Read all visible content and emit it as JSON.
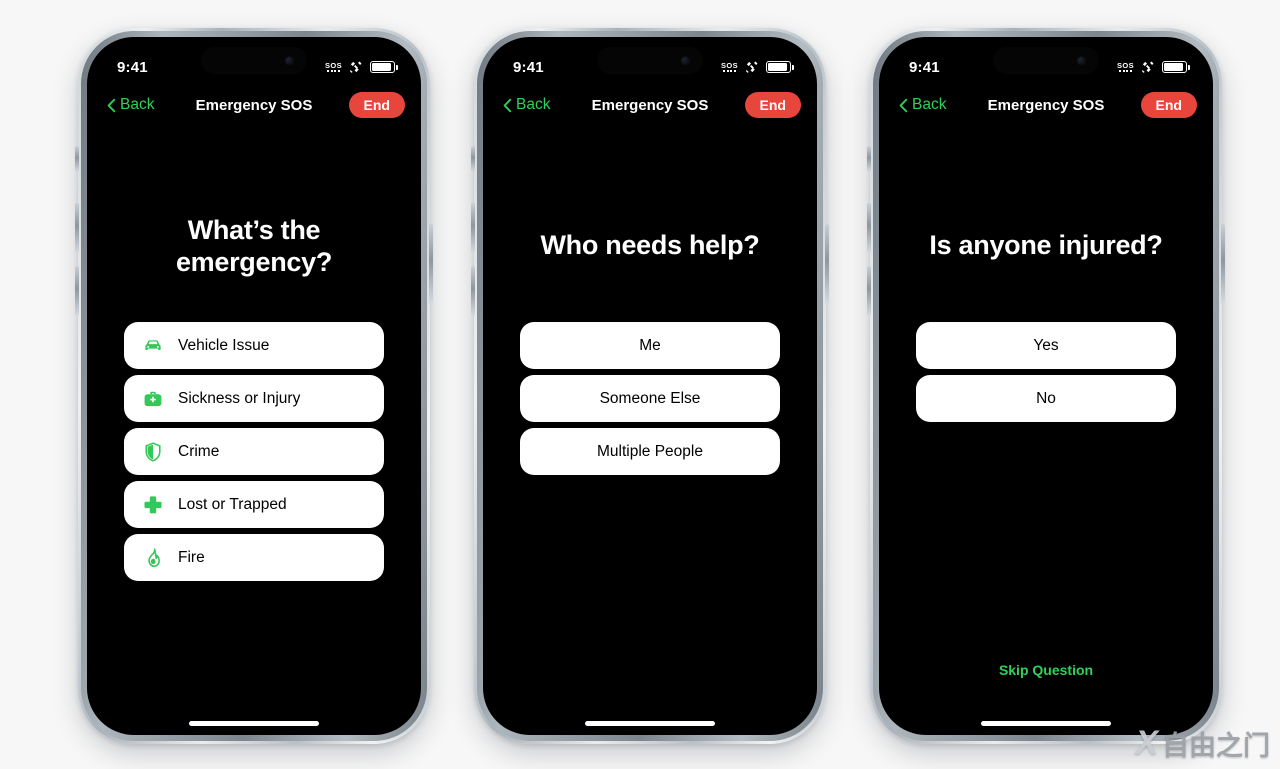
{
  "theme": {
    "page_background": "#f7f7f7",
    "screen_background": "#000000",
    "accent_green": "#30d158",
    "end_button_red": "#e8453c",
    "option_background": "#ffffff",
    "option_text": "#000000"
  },
  "status_bar": {
    "time": "9:41",
    "sos_label": "SOS",
    "satellite_icon": "satellite-icon",
    "battery_icon": "battery-icon"
  },
  "nav_bar": {
    "back_label": "Back",
    "back_icon": "chevron-left-icon",
    "title": "Emergency SOS",
    "end_label": "End"
  },
  "screens": [
    {
      "id": "what-emergency",
      "question": "What’s the emergency?",
      "options": [
        {
          "label": "Vehicle Issue",
          "icon": "car-icon"
        },
        {
          "label": "Sickness or Injury",
          "icon": "medical-bag-icon"
        },
        {
          "label": "Crime",
          "icon": "shield-icon"
        },
        {
          "label": "Lost or Trapped",
          "icon": "cross-icon"
        },
        {
          "label": "Fire",
          "icon": "flame-icon"
        }
      ],
      "skip_label": null
    },
    {
      "id": "who-needs-help",
      "question": "Who needs help?",
      "options": [
        {
          "label": "Me",
          "icon": null
        },
        {
          "label": "Someone Else",
          "icon": null
        },
        {
          "label": "Multiple People",
          "icon": null
        }
      ],
      "skip_label": null
    },
    {
      "id": "is-anyone-injured",
      "question": "Is anyone injured?",
      "options": [
        {
          "label": "Yes",
          "icon": null
        },
        {
          "label": "No",
          "icon": null
        }
      ],
      "skip_label": "Skip Question"
    }
  ],
  "watermark": {
    "mark": "X",
    "text": "自由之门"
  }
}
